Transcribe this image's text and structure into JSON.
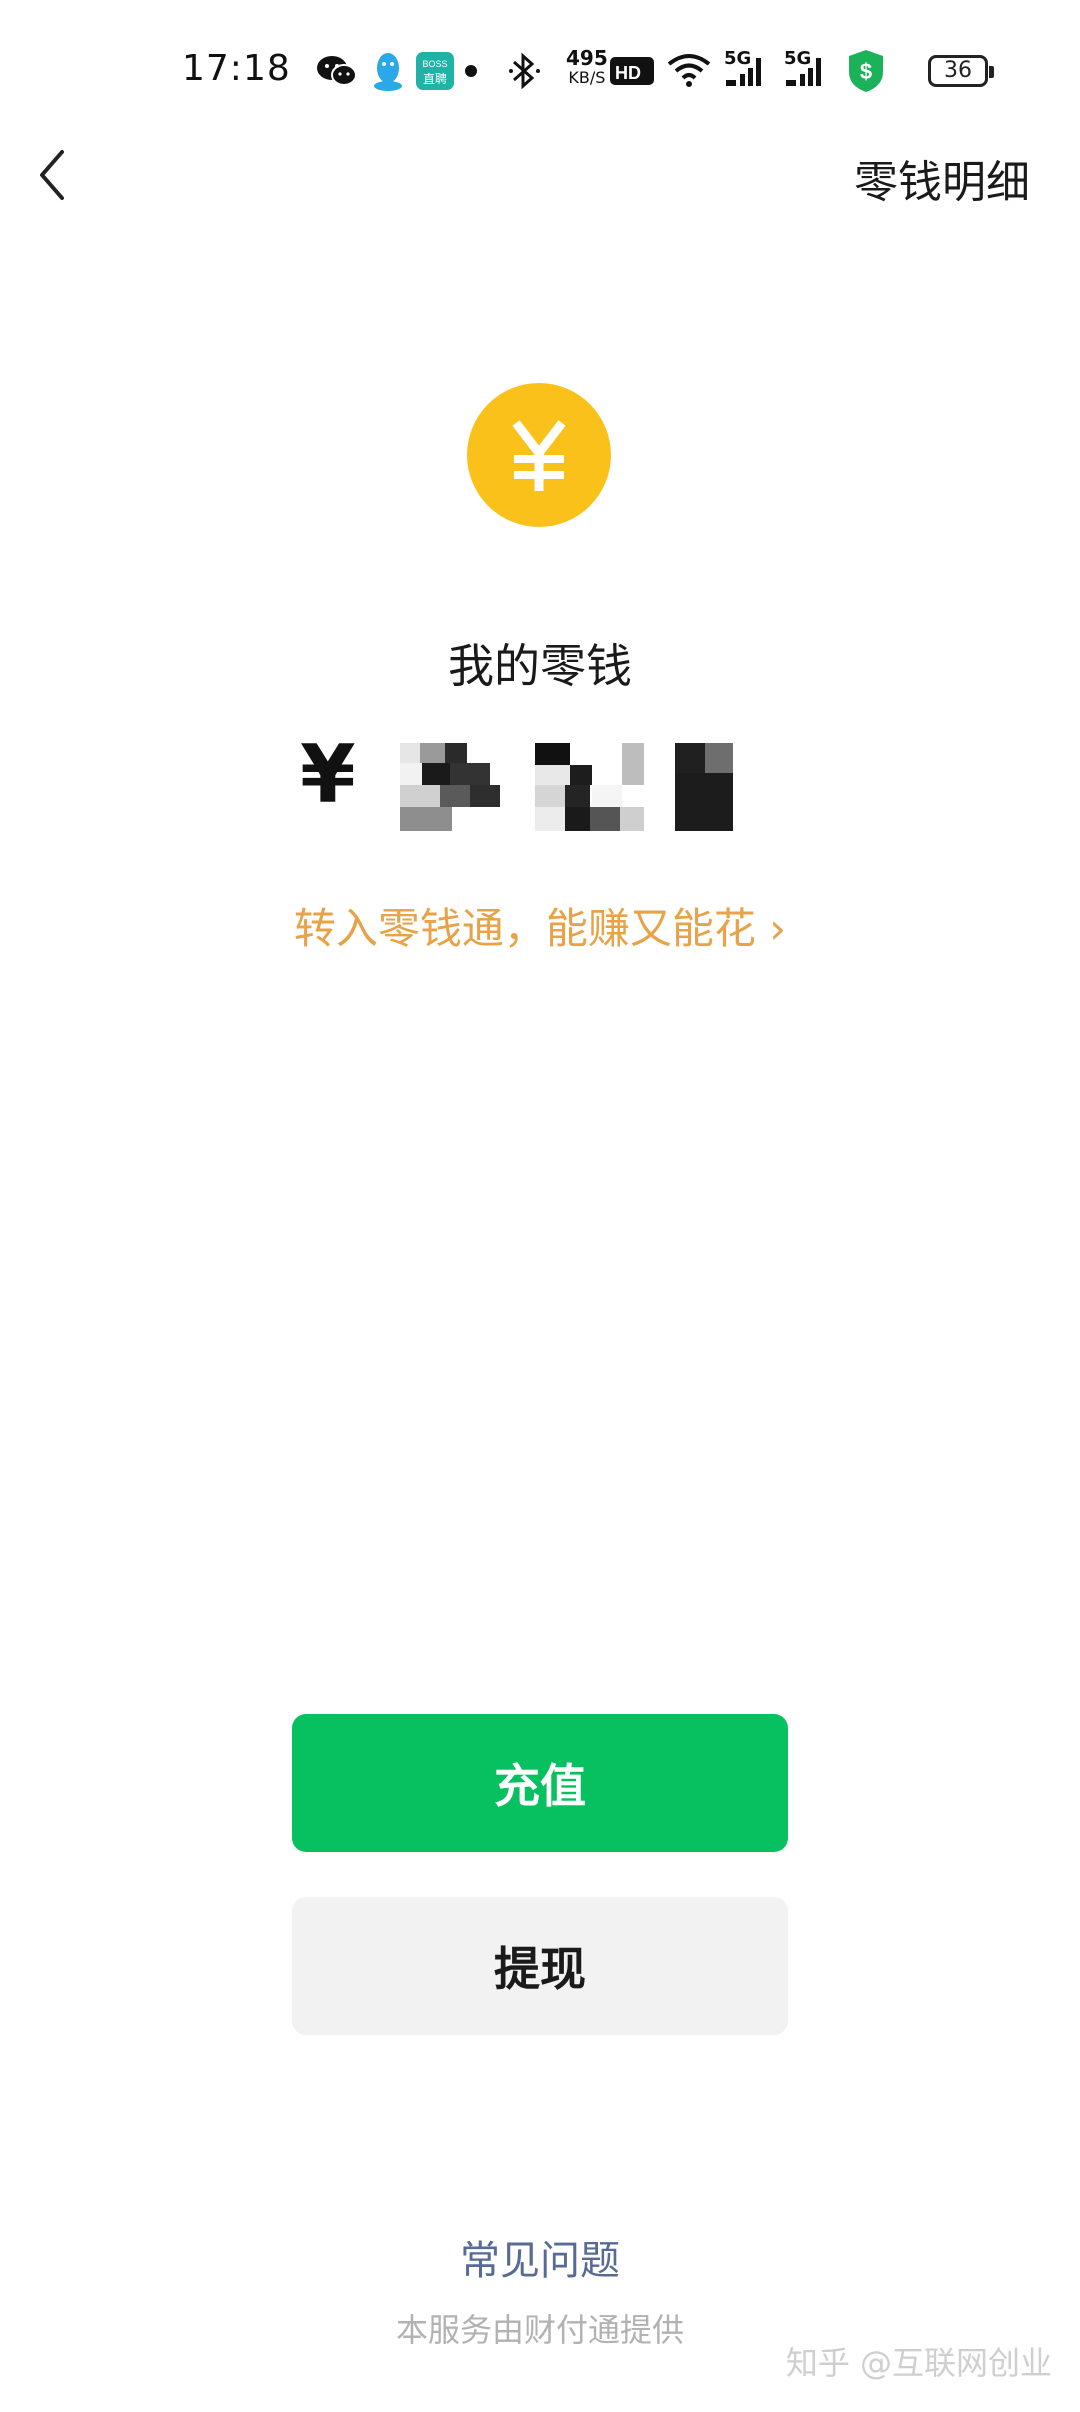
{
  "status_bar": {
    "time": "17:18",
    "net_speed_value": "495",
    "net_speed_unit": "KB/S",
    "hd_label": "HD",
    "signal1_label": "5G",
    "signal2_label": "5G",
    "battery_level": "36",
    "icons": [
      "wechat-icon",
      "qq-icon",
      "boss-app-icon",
      "dot-icon",
      "bluetooth-icon",
      "hd-voice-icon",
      "wifi-icon",
      "signal-icon",
      "signal-icon",
      "shield-dollar-icon",
      "battery-icon"
    ],
    "boss_app_label_top": "BOSS",
    "boss_app_label_bottom": "直聘",
    "shield_symbol": "$"
  },
  "nav": {
    "back_icon": "chevron-left-icon",
    "detail_label": "零钱明细"
  },
  "main": {
    "coin_symbol": "¥",
    "balance_label": "我的零钱",
    "currency_symbol": "¥",
    "balance_obscured": true,
    "promo_text": "转入零钱通，能赚又能花 ›"
  },
  "actions": {
    "recharge_label": "充值",
    "withdraw_label": "提现"
  },
  "footer": {
    "faq_label": "常见问题",
    "provider_note": "本服务由财付通提供",
    "watermark": "知乎 @互联网创业"
  },
  "colors": {
    "primary_green": "#07c160",
    "coin_yellow": "#fbc11b",
    "promo_orange": "#e8a247",
    "link_blue": "#576b95"
  }
}
